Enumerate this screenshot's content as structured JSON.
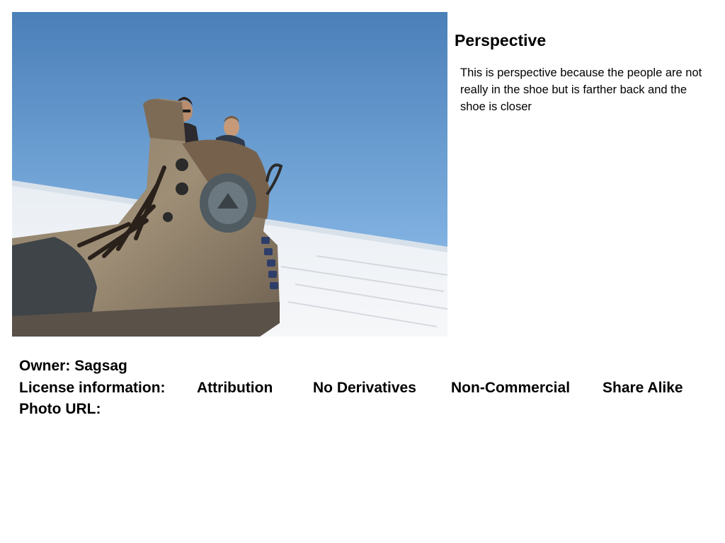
{
  "slide": {
    "title": "Perspective",
    "description": "This is perspective because the people are not really in the shoe  but is  farther back and the shoe is closer",
    "photo": {
      "subject": "giant-boot-perspective-photo"
    },
    "owner": {
      "label": "Owner:",
      "value": "Sagsag"
    },
    "license": {
      "label": "License information:",
      "items": [
        "Attribution",
        "No Derivatives",
        "Non-Commercial",
        "Share Alike"
      ]
    },
    "photo_url": {
      "label": "Photo URL:",
      "value": ""
    }
  }
}
